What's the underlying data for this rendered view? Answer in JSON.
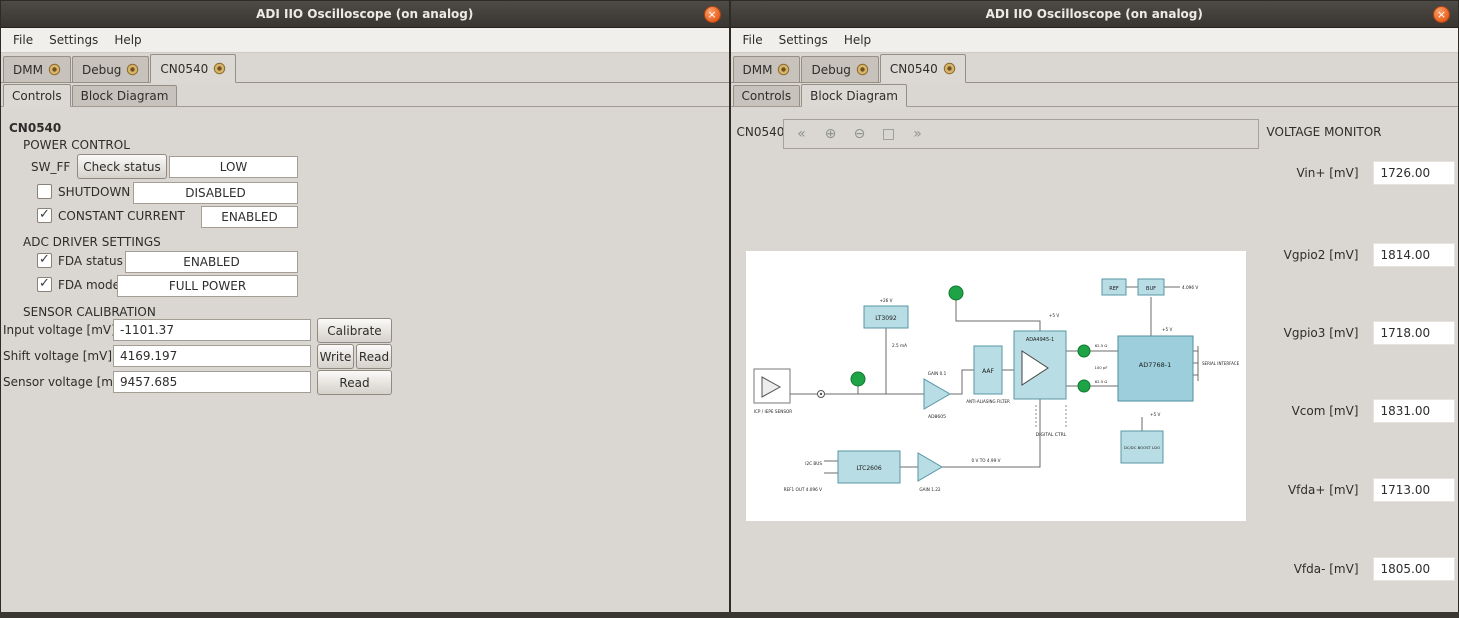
{
  "window": {
    "title": "ADI IIO Oscilloscope (on analog)",
    "close_glyph": "×"
  },
  "menu": {
    "items": [
      "File",
      "Settings",
      "Help"
    ]
  },
  "tabs": {
    "items": [
      "DMM",
      "Debug",
      "CN0540"
    ]
  },
  "subtabs": {
    "items": [
      "Controls",
      "Block Diagram"
    ]
  },
  "controls_panel": {
    "device_title": "CN0540",
    "power_control": {
      "heading": "POWER CONTROL",
      "sw_ff_label": "SW_FF",
      "check_status_button": "Check status",
      "sw_ff_value": "LOW",
      "shutdown_label": "SHUTDOWN",
      "shutdown_value": "DISABLED",
      "constant_current_label": "CONSTANT CURRENT",
      "constant_current_value": "ENABLED"
    },
    "adc_driver": {
      "heading": "ADC DRIVER SETTINGS",
      "fda_status_label": "FDA status",
      "fda_status_value": "ENABLED",
      "fda_mode_label": "FDA mode",
      "fda_mode_value": "FULL POWER"
    },
    "sensor_calibration": {
      "heading": "SENSOR CALIBRATION",
      "input_voltage_label": "Input voltage [mV]",
      "input_voltage_value": "-1101.37",
      "calibrate_button": "Calibrate",
      "shift_voltage_label": "Shift voltage [mV]",
      "shift_voltage_value": "4169.197",
      "write_button": "Write",
      "read_button": "Read",
      "sensor_voltage_label": "Sensor voltage [mV]",
      "sensor_voltage_value": "9457.685",
      "sensor_read_button": "Read"
    }
  },
  "diagram_panel": {
    "device_title": "CN0540",
    "toolbar_icons": [
      "«",
      "⊕",
      "⊖",
      "□",
      "»"
    ],
    "voltage_monitor": {
      "heading": "VOLTAGE MONITOR",
      "rows": [
        {
          "label": "Vin+ [mV]",
          "value": "1726.00"
        },
        {
          "label": "Vgpio2 [mV]",
          "value": "1814.00"
        },
        {
          "label": "Vgpio3 [mV]",
          "value": "1718.00"
        },
        {
          "label": "Vcom [mV]",
          "value": "1831.00"
        },
        {
          "label": "Vfda+ [mV]",
          "value": "1713.00"
        },
        {
          "label": "Vfda- [mV]",
          "value": "1805.00"
        }
      ]
    },
    "diagram": {
      "sensor": "ICP / IEPE SENSOR",
      "lt3092": "LT3092",
      "ad8605": "AD8605",
      "aaf": "AAF",
      "aaf_caption": "ANTI-ALIASING FILTER",
      "ada4945": "ADA4945-1",
      "ad7768": "AD7768-1",
      "ltc2606": "LTC2606",
      "ref": "REF",
      "buf": "BUF",
      "dcdc": "DC/DC BOOST LDO",
      "digital_ctrl": "DIGITAL CTRL",
      "serial_interface": "SERIAL INTERFACE",
      "i2c_bus": "I2C BUS",
      "ref1_out": "REF1 OUT 4.096 V",
      "range_label": "0 V TO 4.99 V",
      "gain_a": "GAIN 0.1",
      "gain_b": "GAIN 1.22",
      "plus5v": "+5 V",
      "plus26v": "+26 V",
      "i_source": "2.5 mA",
      "vref_out": "4.096 V",
      "r_filter": "62.5 Ω",
      "c_filter": "100 pF"
    }
  },
  "colors": {
    "titlebar": "#3a3733",
    "close_button": "#ea5f1e",
    "block_blue": "#b8dde4",
    "block_blue_dark": "#9ccfdb",
    "testpoint_green": "#1ea446"
  }
}
